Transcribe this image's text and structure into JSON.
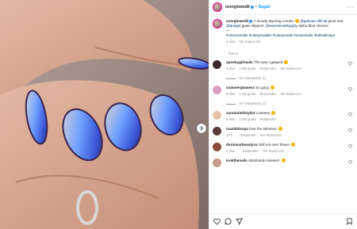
{
  "header": {
    "username": "overglowedit",
    "follow_label": "Seguir",
    "more_label": "···"
  },
  "caption": {
    "username": "overglowedit",
    "text_intro": "A moody layering combo",
    "mention_1": "@gelcare.official",
    "text_mid": "pinot noir,",
    "mention_2": "@dndgel",
    "text_glass": "glass slippers.",
    "mention_3": "@sweetenailsupply",
    "text_end": "aloha blue chrome",
    "dash": "—",
    "hashtags": "#chromenails #cateyenailart #cateyenails #velvetnails #fallnailinspo",
    "age": "5 días",
    "translate_label": "Ver traducción"
  },
  "para_ti_label": "Para ti",
  "comments": [
    {
      "username": "spookygirlnails",
      "text": "The way I gasped",
      "age": "5 días",
      "likes": "1 Me gusta",
      "reply_label": "Responder",
      "translate_label": "Ver traducción",
      "replies_label": "Ver respuestas (1)",
      "avatar_color": "#3a2a2a"
    },
    {
      "username": "summerglowess",
      "text": "So gorg",
      "age": "5 días",
      "likes": "1 Me gusta",
      "reply_label": "Responder",
      "translate_label": "Ver traducción",
      "replies_label": "Ver respuestas (1)",
      "avatar_color": "#d9a0c0"
    },
    {
      "username": "sarahariellstylist",
      "text": "Loveeee",
      "age": "5 días",
      "likes": "1 Me gusta",
      "reply_label": "Responder",
      "translate_label": "",
      "replies_label": "",
      "avatar_color": "#e6c3a8"
    },
    {
      "username": "manibliisspa",
      "text": "love the shimmer",
      "age": "14 h",
      "likes": "",
      "reply_label": "Responder",
      "translate_label": "Ver traducción",
      "replies_label": "",
      "avatar_color": "#5a3a3a"
    },
    {
      "username": "dorismarbeautyco",
      "text": "Still not over these!",
      "age": "5 días",
      "likes": "",
      "reply_label": "Responder",
      "translate_label": "Ver traducción",
      "replies_label": "",
      "avatar_color": "#8a4a3a"
    },
    {
      "username": "lookthenails",
      "text": "Absolutely insane!!!",
      "age": "",
      "likes": "",
      "reply_label": "",
      "translate_label": "",
      "replies_label": "",
      "avatar_color": "#c59b8a"
    }
  ],
  "icons": {
    "like": "heart-icon",
    "comment": "comment-icon",
    "share": "share-icon",
    "save": "bookmark-icon",
    "next": "chevron-right-icon"
  },
  "colors": {
    "link": "#00376b",
    "follow": "#0095f6",
    "muted": "#8e8e8e",
    "verified": "#3897f0"
  }
}
